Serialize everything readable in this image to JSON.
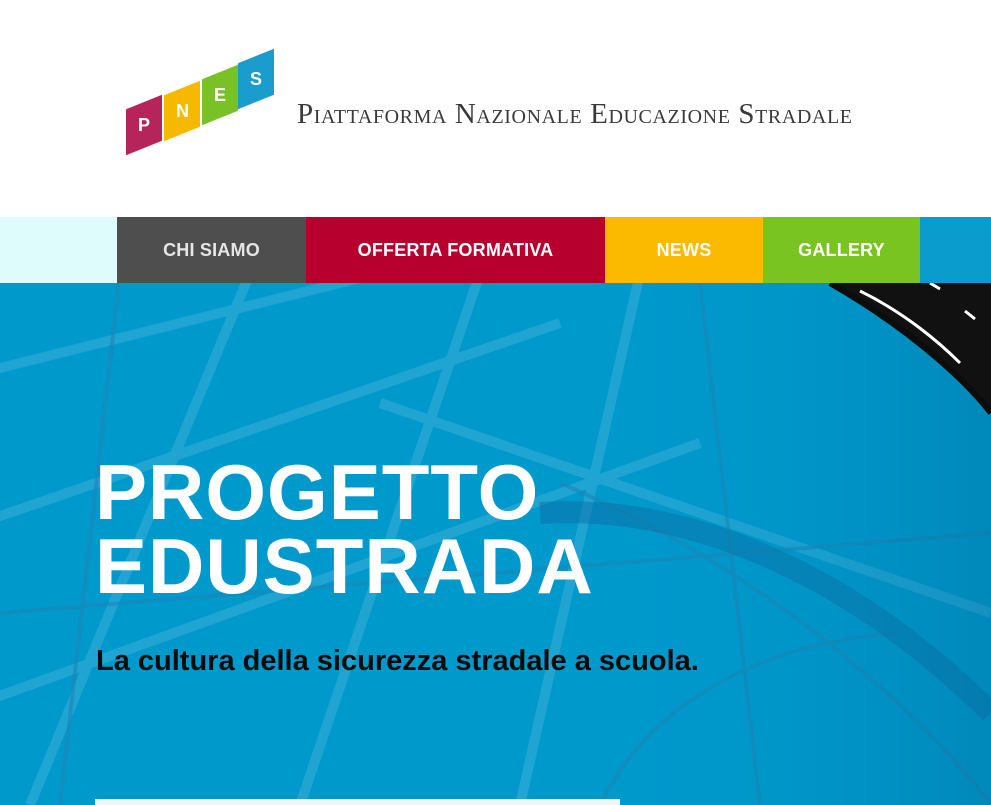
{
  "header": {
    "logo_letters": [
      "P",
      "N",
      "E",
      "S"
    ],
    "logo_colors": [
      "#b5245a",
      "#f6b800",
      "#7ac127",
      "#1a9ccc"
    ],
    "site_title": "Piattaforma Nazionale Educazione Stradale"
  },
  "nav": {
    "items": [
      {
        "label": "CHI SIAMO",
        "color": "#4e4e4e"
      },
      {
        "label": "OFFERTA FORMATIVA",
        "color": "#b8002f"
      },
      {
        "label": "NEWS",
        "color": "#fbba00"
      },
      {
        "label": "GALLERY",
        "color": "#79c420"
      }
    ]
  },
  "hero": {
    "title_line1": "PROGETTO",
    "title_line2": "EDUSTRADA",
    "subtitle": "La cultura della sicurezza stradale a scuola.",
    "background_color": "#0099cc"
  }
}
